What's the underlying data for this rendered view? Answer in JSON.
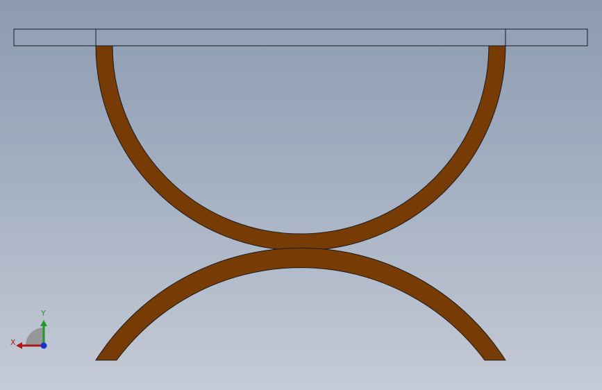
{
  "viewport": {
    "background_top": "#8c9bb0",
    "background_bottom": "#c5cbd6"
  },
  "model": {
    "tabletop_color": "#93a2b8",
    "leg_color": "#773b05",
    "edge_color": "#1a1a1a"
  },
  "triad": {
    "x_label": "X",
    "y_label": "Y",
    "x_color": "#b01818",
    "y_color": "#1e9a2a",
    "z_color": "#1a2fd0"
  }
}
